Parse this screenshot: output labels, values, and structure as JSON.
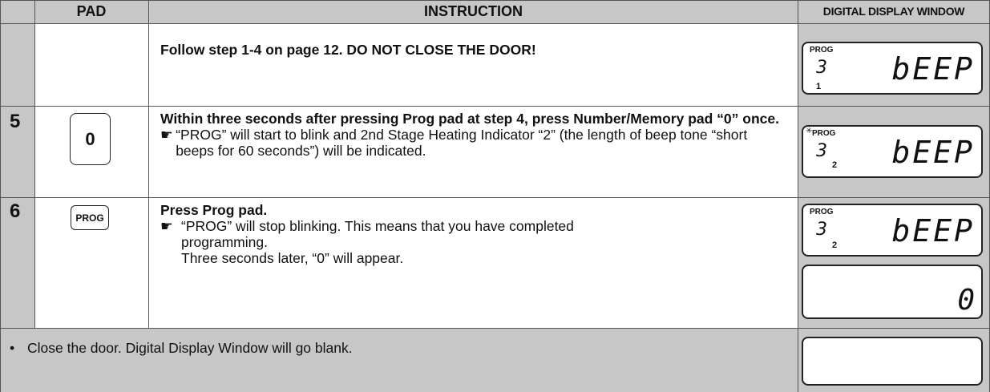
{
  "headers": {
    "pad": "PAD",
    "instruction": "INSTRUCTION",
    "display": "DIGITAL DISPLAY WINDOW"
  },
  "row_intro": {
    "instruction": "Follow step 1-4 on page 12. DO NOT CLOSE THE DOOR!",
    "display": {
      "prog": "PROG",
      "digit": "3",
      "word": "bEEP",
      "sub": "1"
    }
  },
  "row5": {
    "step": "5",
    "pad_label": "0",
    "instruction_bold": "Within three seconds after pressing Prog pad at step 4, press Number/Memory pad “0” once.",
    "arrow": "☛",
    "note": "“PROG” will start to blink and 2nd Stage Heating Indicator “2” (the length of beep tone “short beeps for 60 seconds”) will be indicated.",
    "display": {
      "prog": "PROG",
      "digit": "3",
      "word": "bEEP",
      "sub": "2"
    }
  },
  "row6": {
    "step": "6",
    "pad_label": "PROG",
    "instruction_bold": "Press Prog pad.",
    "arrow": "☛",
    "note_1": "“PROG” will stop blinking. This means that you have completed programming.",
    "note_2": "Three seconds later, “0” will appear.",
    "display": {
      "prog": "PROG",
      "digit": "3",
      "word": "bEEP",
      "sub": "2"
    },
    "display_2": {
      "value": "0"
    }
  },
  "row_final": {
    "bullet": "•",
    "text": "Close the door. Digital Display Window will go blank."
  }
}
